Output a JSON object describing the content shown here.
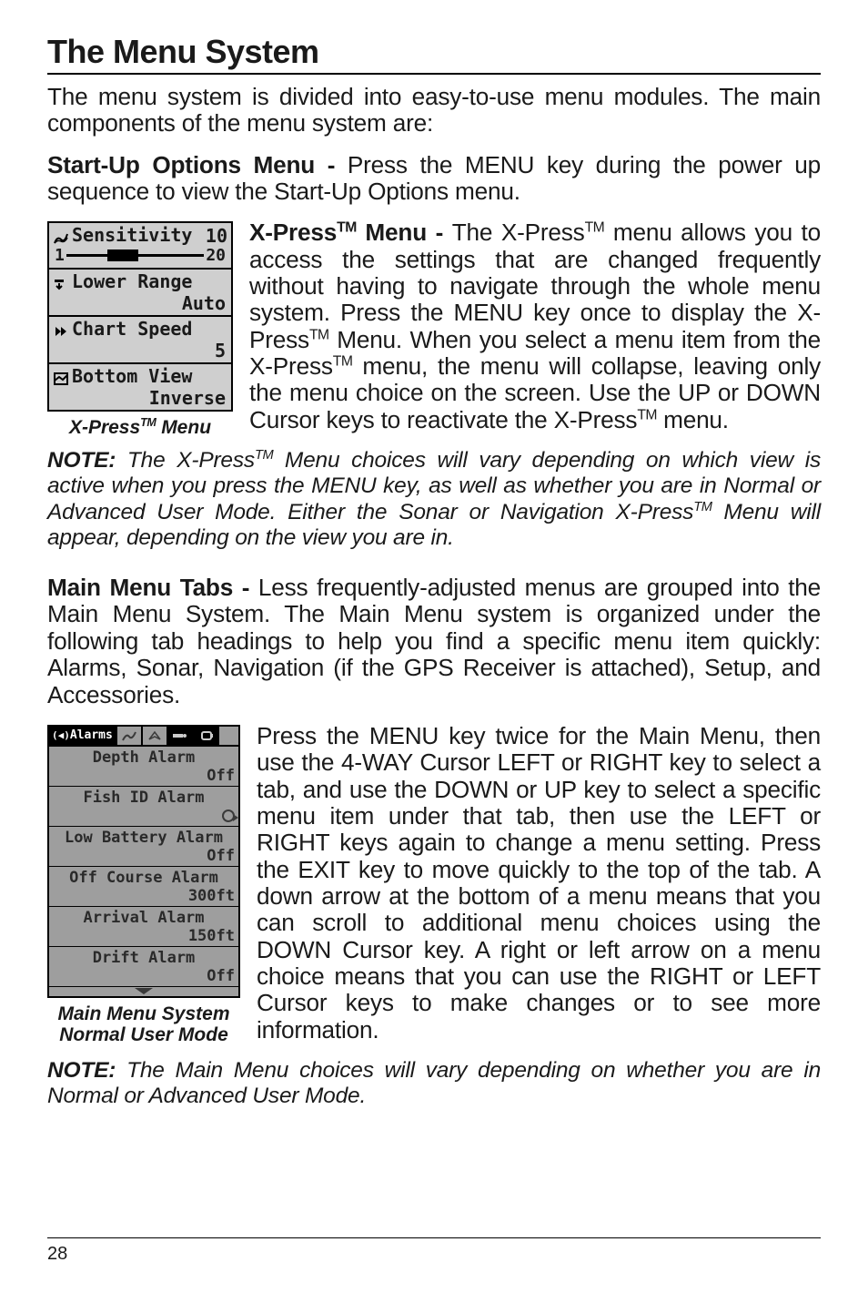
{
  "title": "The Menu System",
  "intro": "The menu system is divided into easy-to-use menu modules. The main components of the menu system are:",
  "startup": {
    "label": "Start-Up Options Menu -",
    "text": " Press the MENU key during the power up sequence to view the Start-Up Options menu."
  },
  "fig1_caption_prefix": "X-Press",
  "fig1_caption_suffix": " Menu",
  "xpress_box": {
    "sensitivity_label": "Sensitivity",
    "sensitivity_value": "10",
    "slider_min": "1",
    "slider_max": "20",
    "lower_range_label": "Lower Range",
    "lower_range_value": "Auto",
    "chart_speed_label": "Chart Speed",
    "chart_speed_value": "5",
    "bottom_view_label": "Bottom View",
    "bottom_view_value": "Inverse"
  },
  "xpress_para": {
    "label_prefix": "X-Press",
    "label_suffix": " Menu - ",
    "text1": "The X-Press",
    "text2": " menu allows you to access the settings that are changed frequently without having to navigate through the whole menu system. Press the MENU key once to display the X-Press",
    "text3": " Menu. When you select a menu item from the X-Press",
    "text4": " menu, the menu will collapse, leaving only the menu choice on the screen. Use the UP or DOWN Cursor keys to reactivate the X-Press",
    "text5": " menu."
  },
  "xpress_note": {
    "label": "NOTE:",
    "text1": " The X-Press",
    "text2": " Menu choices will vary depending on which view is active when you press the MENU key, as well as whether you are in Normal or Advanced User Mode. Either the Sonar or Navigation X-Press",
    "text3": " Menu will appear, depending on the view you are in."
  },
  "mainmenu_intro": {
    "label": "Main Menu Tabs -",
    "text": " Less frequently-adjusted menus are grouped into the Main Menu System. The Main Menu system is organized under the following tab headings to help you find a specific menu item quickly: Alarms, Sonar, Navigation (if the GPS Receiver is attached), Setup, and Accessories."
  },
  "fig2_caption_line1": "Main Menu System",
  "fig2_caption_line2": "Normal User Mode",
  "mainmenu_box": {
    "active_tab": "Alarms",
    "rows": [
      {
        "label": "Depth Alarm",
        "value": "Off"
      },
      {
        "label": "Fish ID Alarm",
        "value": ""
      },
      {
        "label": "Low Battery Alarm",
        "value": "Off"
      },
      {
        "label": "Off Course Alarm",
        "value": "300ft"
      },
      {
        "label": "Arrival Alarm",
        "value": "150ft"
      },
      {
        "label": "Drift Alarm",
        "value": "Off"
      }
    ]
  },
  "mainmenu_para": "Press the MENU key twice for the Main Menu, then use the 4-WAY Cursor LEFT or RIGHT key to select a tab, and use the DOWN or UP key to select a specific menu item under that tab, then use the LEFT or RIGHT keys again to change a menu setting. Press the EXIT key to move quickly to the top of the tab. A down arrow at the bottom of a menu means that you can scroll to additional menu choices using the DOWN Cursor key. A right or left arrow on a menu choice means that you can use the RIGHT or LEFT Cursor keys to make changes or to see more information.",
  "mainmenu_note": {
    "label": "NOTE:",
    "text": " The Main Menu choices will vary depending on whether you are in Normal or Advanced User Mode."
  },
  "page_number": "28",
  "tm": "TM"
}
